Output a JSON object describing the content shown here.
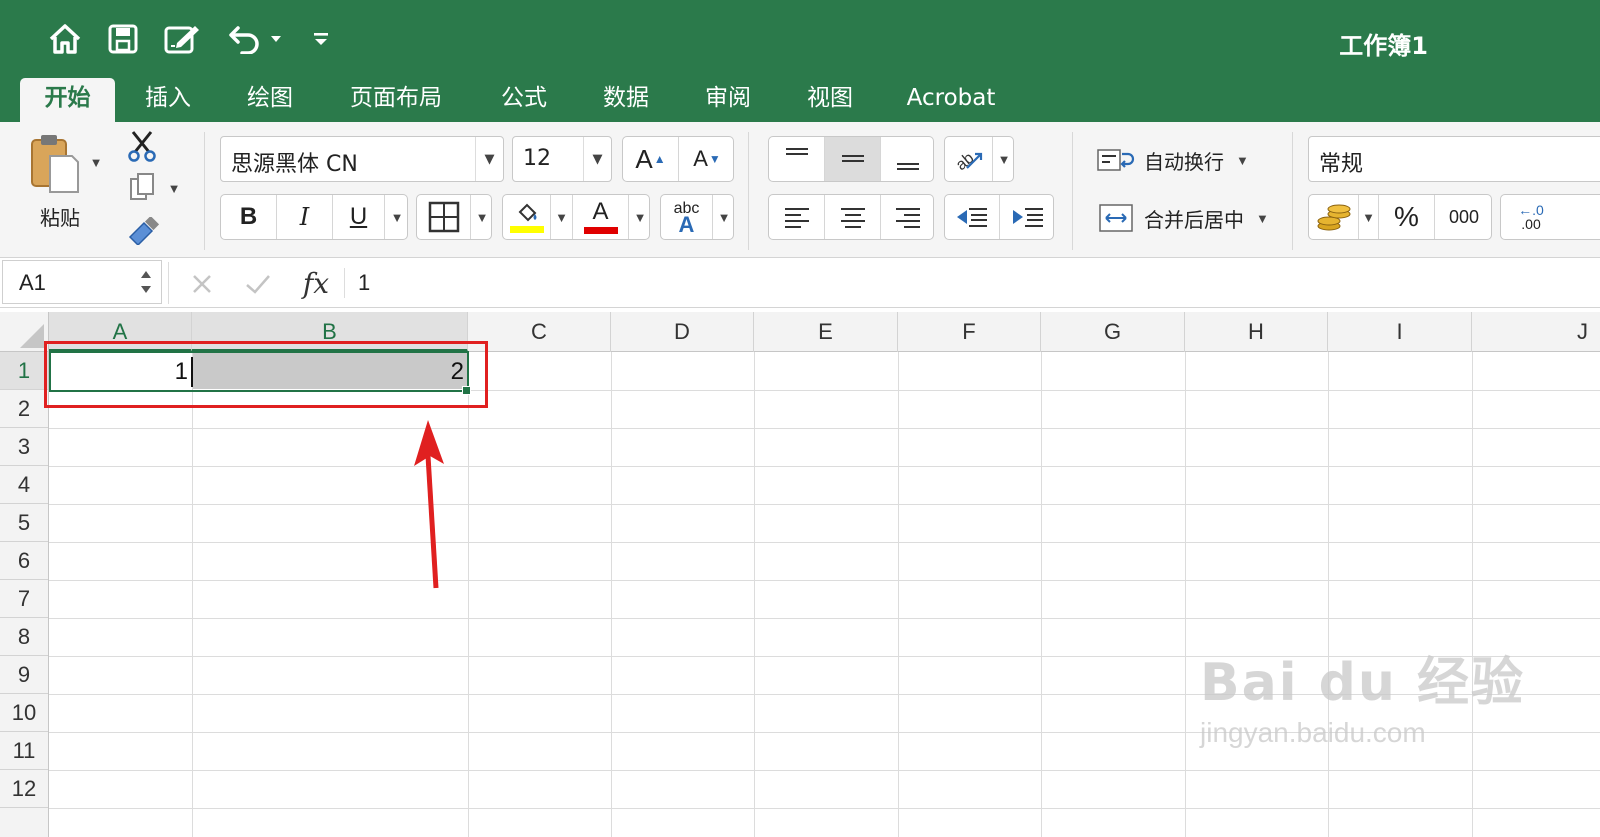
{
  "app": {
    "title": "工作簿1",
    "accent_color": "#2b7a4b",
    "quick_access": [
      "home-icon",
      "save-icon",
      "edit-document-icon",
      "undo-icon",
      "customize-icon"
    ]
  },
  "tabs": [
    {
      "label": "开始",
      "active": true
    },
    {
      "label": "插入",
      "active": false
    },
    {
      "label": "绘图",
      "active": false
    },
    {
      "label": "页面布局",
      "active": false
    },
    {
      "label": "公式",
      "active": false
    },
    {
      "label": "数据",
      "active": false
    },
    {
      "label": "审阅",
      "active": false
    },
    {
      "label": "视图",
      "active": false
    },
    {
      "label": "Acrobat",
      "active": false
    }
  ],
  "ribbon": {
    "clipboard": {
      "paste_label": "粘贴"
    },
    "font": {
      "font_name": "思源黑体 CN",
      "font_size": "12",
      "increase_glyph": "A",
      "decrease_glyph": "A",
      "bold": "B",
      "italic": "I",
      "underline": "U",
      "font_color_glyph": "A",
      "highlight_color": "#ffff00",
      "font_color": "#e00000",
      "phonetic_top": "abc",
      "phonetic_bottom": "A"
    },
    "alignment": {
      "wrap_text": "自动换行",
      "merge_center": "合并后居中"
    },
    "number": {
      "format": "常规",
      "percent": "%",
      "thousands": "000",
      "decimal_top": "←.0",
      "decimal_bottom": ".00"
    }
  },
  "formula_bar": {
    "name_box": "A1",
    "fx": "fx",
    "content": "1"
  },
  "sheet": {
    "columns": [
      "A",
      "B",
      "C",
      "D",
      "E",
      "F",
      "G",
      "H",
      "I",
      "J"
    ],
    "selected_columns": [
      "A",
      "B"
    ],
    "rows": [
      "1",
      "2",
      "3",
      "4",
      "5",
      "6",
      "7",
      "8",
      "9",
      "10",
      "11",
      "12"
    ],
    "selected_row": "1",
    "cells": {
      "A1": "1",
      "B1": "2"
    }
  },
  "watermark": {
    "line1": "Bai du 经验",
    "line2": "jingyan.baidu.com"
  }
}
